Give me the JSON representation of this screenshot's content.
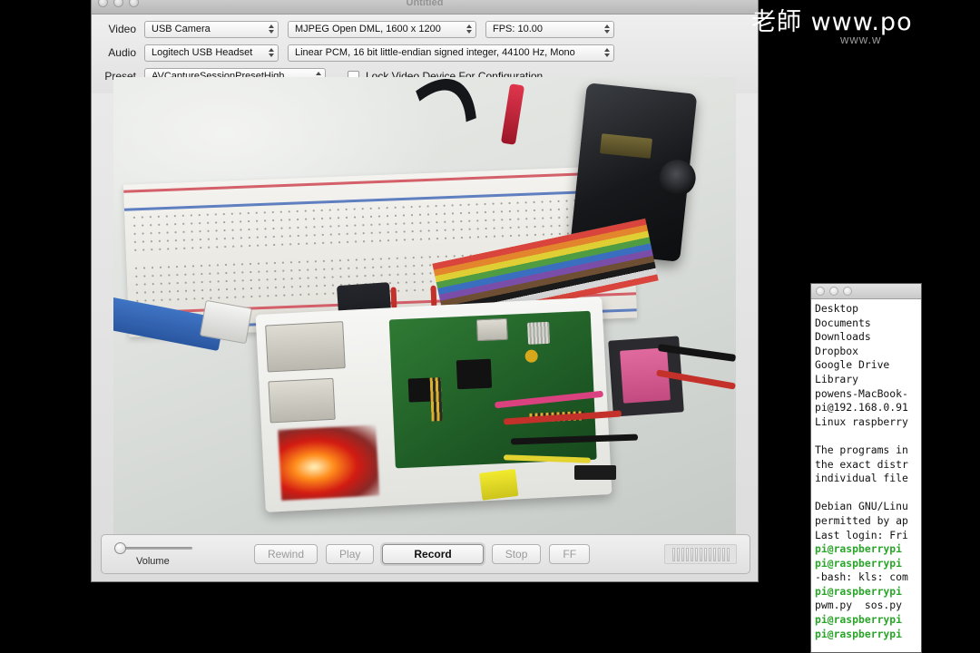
{
  "watermark": {
    "main": "老師 www.po",
    "sub": "www.w"
  },
  "capture_window": {
    "title": "Untitled",
    "traffic_lights": [
      "close",
      "minimize",
      "zoom"
    ],
    "settings": {
      "video_label": "Video",
      "video_device": "USB Camera",
      "video_format": "MJPEG Open DML, 1600 x 1200",
      "video_fps": "FPS: 10.00",
      "audio_label": "Audio",
      "audio_device": "Logitech USB Headset",
      "audio_format": "Linear PCM, 16 bit little-endian signed integer, 44100 Hz, Mono",
      "preset_label": "Preset",
      "preset_value": "AVCaptureSessionPresetHigh",
      "lock_label": "Lock Video Device For Configuration",
      "lock_checked": false
    },
    "transport": {
      "volume_label": "Volume",
      "volume_value": 0,
      "rewind_label": "Rewind",
      "play_label": "Play",
      "record_label": "Record",
      "stop_label": "Stop",
      "ff_label": "FF",
      "meter_segments": 13
    },
    "preview": {
      "description": "Live camera view of a Raspberry Pi in a white case on a desk with a solderless breadboard, rainbow ribbon cable, a black servo motor, red and black jumper wires, an ethernet cable and an HDMI cable; a red power LED is glowing."
    }
  },
  "terminal": {
    "traffic_lights": [
      "close",
      "minimize",
      "zoom"
    ],
    "lines": [
      {
        "text": "Desktop",
        "type": "output"
      },
      {
        "text": "Documents",
        "type": "output"
      },
      {
        "text": "Downloads",
        "type": "output"
      },
      {
        "text": "Dropbox",
        "type": "output"
      },
      {
        "text": "Google Drive",
        "type": "output"
      },
      {
        "text": "Library",
        "type": "output"
      },
      {
        "text": "powens-MacBook-",
        "type": "output"
      },
      {
        "text": "pi@192.168.0.91",
        "type": "output"
      },
      {
        "text": "Linux raspberry",
        "type": "output"
      },
      {
        "text": "",
        "type": "blank"
      },
      {
        "text": "The programs in",
        "type": "output"
      },
      {
        "text": "the exact distr",
        "type": "output"
      },
      {
        "text": "individual file",
        "type": "output"
      },
      {
        "text": "",
        "type": "blank"
      },
      {
        "text": "Debian GNU/Linu",
        "type": "output"
      },
      {
        "text": "permitted by ap",
        "type": "output"
      },
      {
        "text": "Last login: Fri",
        "type": "output"
      },
      {
        "text": "pi@raspberrypi ",
        "type": "prompt"
      },
      {
        "text": "pi@raspberrypi ",
        "type": "prompt"
      },
      {
        "text": "-bash: kls: com",
        "type": "output"
      },
      {
        "text": "pi@raspberrypi ",
        "type": "prompt"
      },
      {
        "text": "pwm.py  sos.py",
        "type": "output"
      },
      {
        "text": "pi@raspberrypi ",
        "type": "prompt"
      },
      {
        "text": "pi@raspberrypi ",
        "type": "prompt"
      }
    ]
  },
  "colors": {
    "prompt_green": "#2aa52a",
    "window_chrome": "#e2e2e2",
    "led_red": "#d21a12"
  }
}
